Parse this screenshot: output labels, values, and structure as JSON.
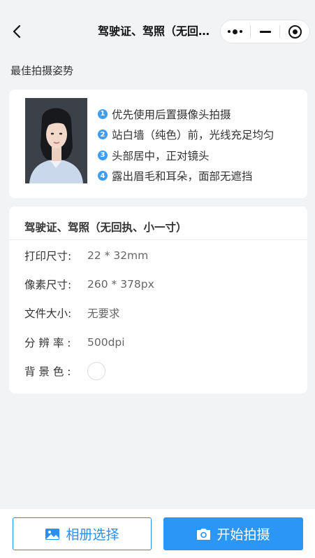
{
  "nav": {
    "title": "驾驶证、驾照（无回执..."
  },
  "section_title": "最佳拍摄姿势",
  "pose_tips": [
    {
      "num": "1",
      "text": "优先使用后置摄像头拍摄"
    },
    {
      "num": "2",
      "text": "站白墙（纯色）前，光线充足均匀"
    },
    {
      "num": "3",
      "text": "头部居中，正对镜头"
    },
    {
      "num": "4",
      "text": "露出眉毛和耳朵，面部无遮挡"
    }
  ],
  "spec": {
    "name": "驾驶证、驾照（无回执、小一寸）",
    "rows": [
      {
        "label": "打印尺寸:",
        "value": "22 * 32mm"
      },
      {
        "label": "像素尺寸:",
        "value": "260 * 378px"
      },
      {
        "label": "文件大小:",
        "value": "无要求"
      },
      {
        "label": "分 辨 率 :",
        "value": "500dpi"
      },
      {
        "label": "背 景 色 :",
        "value": ""
      }
    ],
    "background_color": "#ffffff"
  },
  "bottom": {
    "album_label": "相册选择",
    "shoot_label": "开始拍摄"
  },
  "colors": {
    "accent": "#2b96f5",
    "tip_badge": "#3d9ef4",
    "page_bg": "#f2f3f5"
  },
  "icons": {
    "back": "chevron-left-icon",
    "more": "more-dots-icon",
    "minimize": "minus-icon",
    "close": "target-circle-icon",
    "album": "image-icon",
    "camera": "camera-icon"
  }
}
